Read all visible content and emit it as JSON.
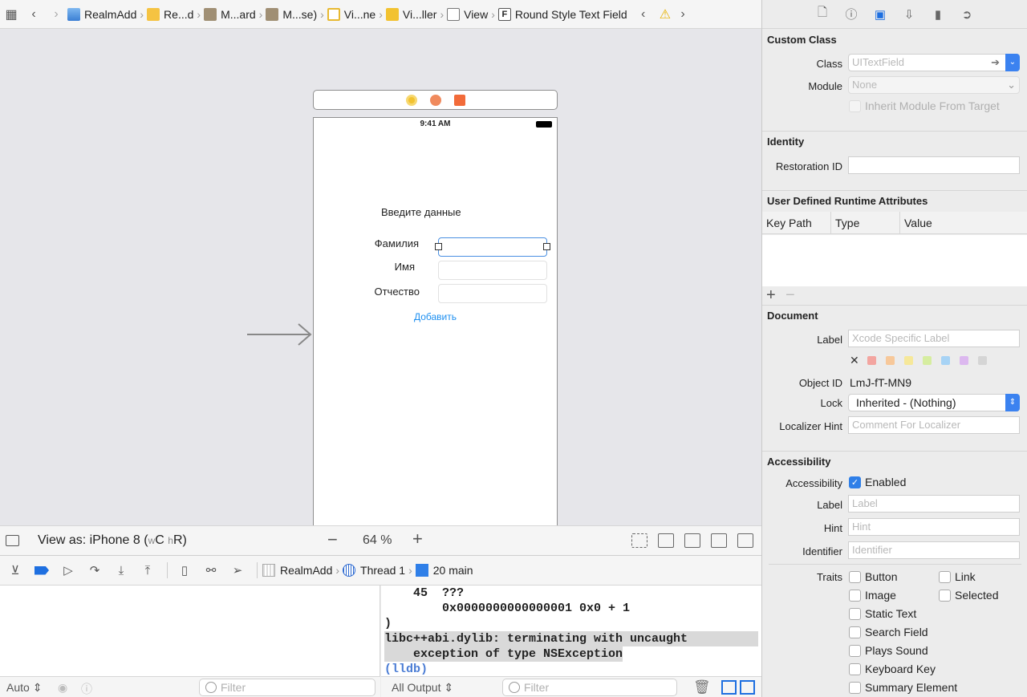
{
  "jumpbar": {
    "crumbs": [
      {
        "label": "RealmAdd",
        "icon": "project-icon"
      },
      {
        "label": "Re...d",
        "icon": "folder-icon"
      },
      {
        "label": "M...ard",
        "icon": "storyboard-icon"
      },
      {
        "label": "M...se)",
        "icon": "storyboard-icon"
      },
      {
        "label": "Vi...ne",
        "icon": "scene-icon"
      },
      {
        "label": "Vi...ller",
        "icon": "view-controller-icon"
      },
      {
        "label": "View",
        "icon": "view-icon"
      },
      {
        "label": "Round Style Text Field",
        "icon": "text-field-icon"
      }
    ],
    "f_glyph": "F"
  },
  "phone": {
    "time": "9:41 AM",
    "title": "Введите данные",
    "labels": {
      "last_name": "Фамилия",
      "first_name": "Имя",
      "patronymic": "Отчество"
    },
    "button": "Добавить"
  },
  "canvasbar": {
    "view_as_prefix": "View as: iPhone 8 (",
    "w_class": "w",
    "w_val": "C",
    "h_class": "h",
    "h_val": "R",
    "suffix": ")",
    "zoom": "64 %"
  },
  "debugbar": {
    "target": "RealmAdd",
    "thread": "Thread 1",
    "frame": "20 main"
  },
  "console": {
    "line1": "    45  ???",
    "line2": "        0x0000000000000001 0x0 + 1",
    "line3": ")",
    "line4": "libc++abi.dylib: terminating with uncaught",
    "line5": "    exception of type NSException",
    "line6": "(lldb)"
  },
  "filters": {
    "var_scope": "Auto",
    "filter_placeholder": "Filter",
    "output_scope": "All Output"
  },
  "inspector": {
    "custom_class": {
      "title": "Custom Class",
      "class_label": "Class",
      "class_placeholder": "UITextField",
      "module_label": "Module",
      "module_placeholder": "None",
      "inherit_label": "Inherit Module From Target"
    },
    "identity": {
      "title": "Identity",
      "restoration_label": "Restoration ID"
    },
    "runtime": {
      "title": "User Defined Runtime Attributes",
      "col_key": "Key Path",
      "col_type": "Type",
      "col_value": "Value"
    },
    "document": {
      "title": "Document",
      "label_label": "Label",
      "label_placeholder": "Xcode Specific Label",
      "object_id_label": "Object ID",
      "object_id": "LmJ-fT-MN9",
      "lock_label": "Lock",
      "lock_value": "Inherited - (Nothing)",
      "localizer_label": "Localizer Hint",
      "localizer_placeholder": "Comment For Localizer",
      "swatch_colors": [
        "#f3a5a0",
        "#f7c89a",
        "#f6e89a",
        "#d6eda0",
        "#a7d3f5",
        "#dcb8ef",
        "#d5d5d5"
      ]
    },
    "accessibility": {
      "title": "Accessibility",
      "acc_label": "Accessibility",
      "enabled": "Enabled",
      "label_label": "Label",
      "label_placeholder": "Label",
      "hint_label": "Hint",
      "hint_placeholder": "Hint",
      "identifier_label": "Identifier",
      "identifier_placeholder": "Identifier",
      "traits_label": "Traits",
      "traits": [
        "Button",
        "Link",
        "Image",
        "Selected",
        "Static Text",
        "Search Field",
        "Plays Sound",
        "Keyboard Key",
        "Summary Element"
      ]
    }
  }
}
